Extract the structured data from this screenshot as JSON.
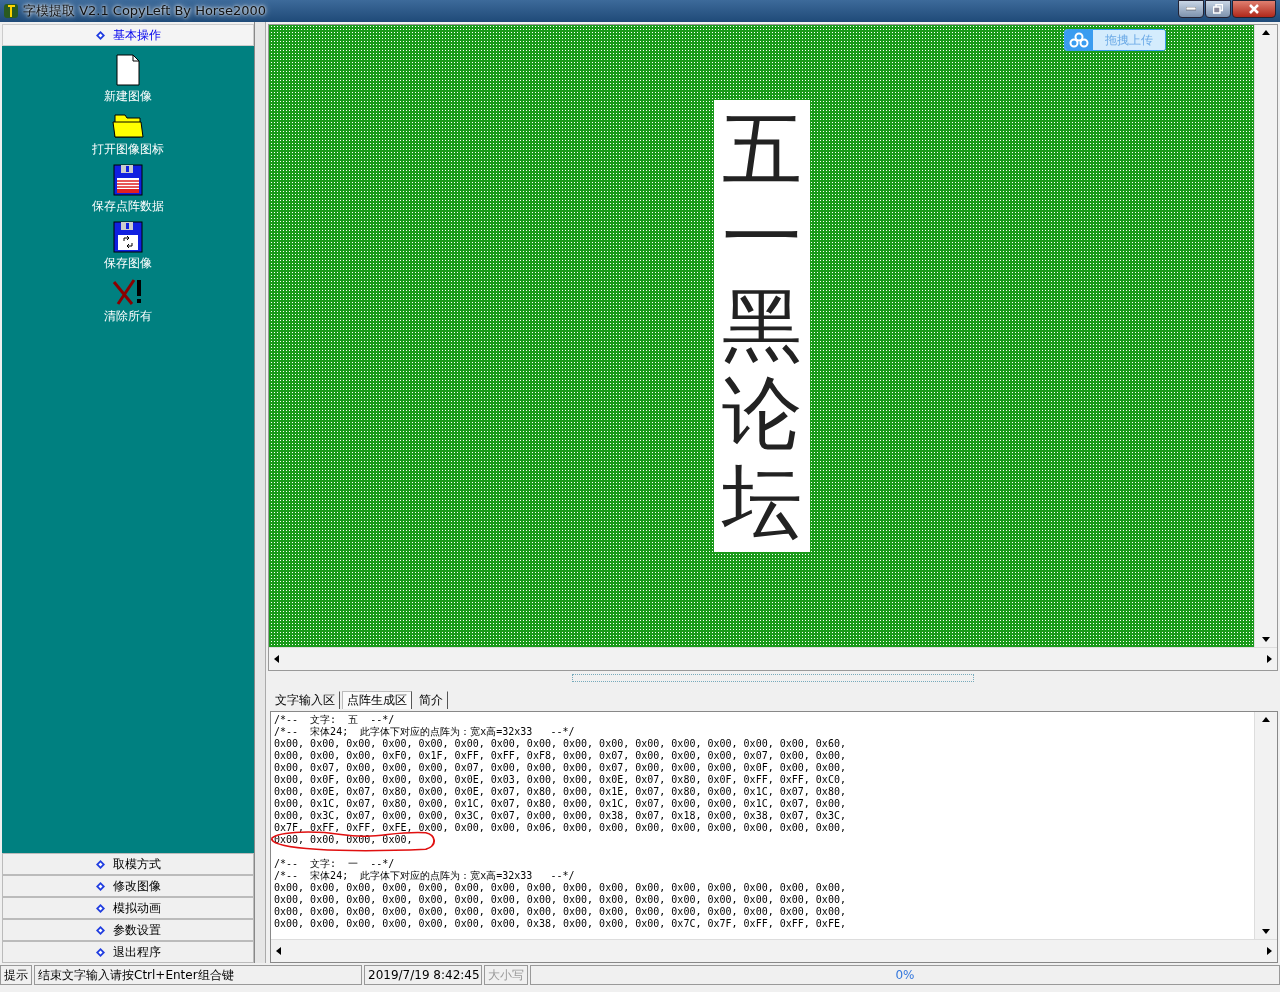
{
  "window": {
    "title": "字模提取 V2.1  CopyLeft By Horse2000"
  },
  "sidebar": {
    "header": "基本操作",
    "tools": [
      {
        "label": "新建图像",
        "kind": "page"
      },
      {
        "label": "打开图像图标",
        "kind": "folder"
      },
      {
        "label": "保存点阵数据",
        "kind": "floppy-data"
      },
      {
        "label": "保存图像",
        "kind": "floppy-image"
      },
      {
        "label": "清除所有",
        "kind": "clear"
      }
    ],
    "groups": [
      {
        "label": "取模方式"
      },
      {
        "label": "修改图像"
      },
      {
        "label": "模拟动画"
      },
      {
        "label": "参数设置"
      },
      {
        "label": "退出程序"
      }
    ]
  },
  "canvas": {
    "preview_text": "五一黑论坛",
    "upload_button": "拖拽上传"
  },
  "tabs": [
    {
      "label": "文字输入区",
      "selected": false
    },
    {
      "label": "点阵生成区",
      "selected": true
    },
    {
      "label": "简介",
      "selected": false
    }
  ],
  "output_blocks": [
    {
      "lines": [
        "/*--  文字:  五  --*/",
        "/*--  宋体24;  此字体下对应的点阵为：宽x高=32x33   --*/",
        "0x00, 0x00, 0x00, 0x00, 0x00, 0x00, 0x00, 0x00, 0x00, 0x00, 0x00, 0x00, 0x00, 0x00, 0x00, 0x60,",
        "0x00, 0x00, 0x00, 0xF0, 0x1F, 0xFF, 0xFF, 0xF8, 0x00, 0x07, 0x00, 0x00, 0x00, 0x07, 0x00, 0x00,",
        "0x00, 0x07, 0x00, 0x00, 0x00, 0x07, 0x00, 0x00, 0x00, 0x07, 0x00, 0x00, 0x00, 0x0F, 0x00, 0x00,",
        "0x00, 0x0F, 0x00, 0x00, 0x00, 0x0E, 0x03, 0x00, 0x00, 0x0E, 0x07, 0x80, 0x0F, 0xFF, 0xFF, 0xC0,",
        "0x00, 0x0E, 0x07, 0x80, 0x00, 0x0E, 0x07, 0x80, 0x00, 0x1E, 0x07, 0x80, 0x00, 0x1C, 0x07, 0x80,",
        "0x00, 0x1C, 0x07, 0x80, 0x00, 0x1C, 0x07, 0x80, 0x00, 0x1C, 0x07, 0x00, 0x00, 0x1C, 0x07, 0x00,",
        "0x00, 0x3C, 0x07, 0x00, 0x00, 0x3C, 0x07, 0x00, 0x00, 0x38, 0x07, 0x18, 0x00, 0x38, 0x07, 0x3C,",
        "0x7F, 0xFF, 0xFF, 0xFE, 0x00, 0x00, 0x00, 0x06, 0x00, 0x00, 0x00, 0x00, 0x00, 0x00, 0x00, 0x00,",
        "0x00, 0x00, 0x00, 0x00,"
      ],
      "circled_last_line": true
    },
    {
      "lines": [
        "/*--  文字:  一  --*/",
        "/*--  宋体24;  此字体下对应的点阵为：宽x高=32x33   --*/",
        "0x00, 0x00, 0x00, 0x00, 0x00, 0x00, 0x00, 0x00, 0x00, 0x00, 0x00, 0x00, 0x00, 0x00, 0x00, 0x00,",
        "0x00, 0x00, 0x00, 0x00, 0x00, 0x00, 0x00, 0x00, 0x00, 0x00, 0x00, 0x00, 0x00, 0x00, 0x00, 0x00,",
        "0x00, 0x00, 0x00, 0x00, 0x00, 0x00, 0x00, 0x00, 0x00, 0x00, 0x00, 0x00, 0x00, 0x00, 0x00, 0x00,",
        "0x00, 0x00, 0x00, 0x00, 0x00, 0x00, 0x00, 0x38, 0x00, 0x00, 0x00, 0x7C, 0x7F, 0xFF, 0xFF, 0xFE,"
      ],
      "circled_last_line": false
    }
  ],
  "status_bar": {
    "label": "提示",
    "message": "结束文字输入请按Ctrl+Enter组合键",
    "datetime": "2019/7/19 8:42:45",
    "caps": "大小写",
    "progress": "0%"
  }
}
